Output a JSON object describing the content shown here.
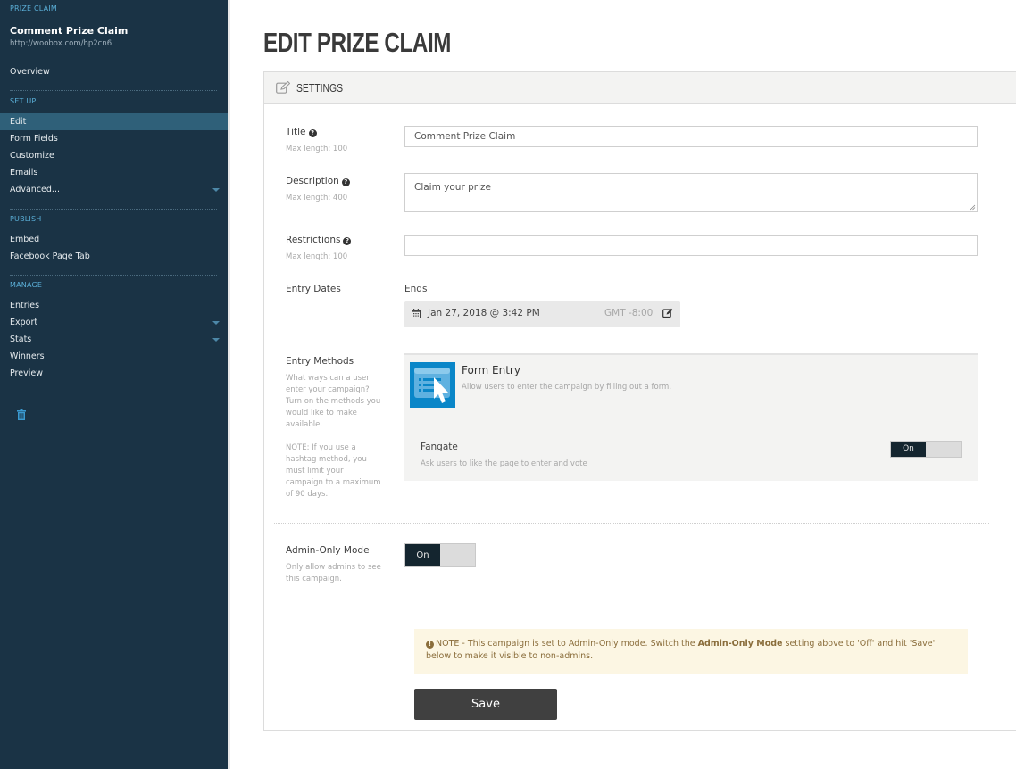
{
  "sidebar": {
    "kicker": "PRIZE CLAIM",
    "campaign_title": "Comment Prize Claim",
    "campaign_url": "http://woobox.com/hp2cn6",
    "overview": "Overview",
    "sections": {
      "setup": "SET UP",
      "publish": "PUBLISH",
      "manage": "MANAGE"
    },
    "setup_items": [
      {
        "label": "Edit",
        "active": true
      },
      {
        "label": "Form Fields"
      },
      {
        "label": "Customize"
      },
      {
        "label": "Emails"
      },
      {
        "label": "Advanced...",
        "has_caret": true
      }
    ],
    "publish_items": [
      {
        "label": "Embed"
      },
      {
        "label": "Facebook Page Tab"
      }
    ],
    "manage_items": [
      {
        "label": "Entries"
      },
      {
        "label": "Export",
        "has_caret": true
      },
      {
        "label": "Stats",
        "has_caret": true
      },
      {
        "label": "Winners"
      },
      {
        "label": "Preview"
      }
    ],
    "delete_icon": "trash-icon"
  },
  "main": {
    "page_title": "EDIT PRIZE CLAIM",
    "panel_title": "SETTINGS",
    "fields": {
      "title": {
        "label": "Title",
        "hint": "Max length: 100",
        "value": "Comment Prize Claim"
      },
      "description": {
        "label": "Description",
        "hint": "Max length: 400",
        "value": "Claim your prize"
      },
      "restrictions": {
        "label": "Restrictions",
        "hint": "Max length: 100",
        "value": ""
      },
      "entry_dates": {
        "label": "Entry Dates",
        "ends_label": "Ends",
        "ends_value": "Jan 27, 2018 @ 3:42 PM",
        "timezone": "GMT -8:00"
      }
    },
    "entry_methods": {
      "label": "Entry Methods",
      "help": "What ways can a user enter your campaign? Turn on the methods you would like to make available.",
      "note": "NOTE: If you use a hashtag method, you must limit your campaign to a maximum of 90 days.",
      "form_entry": {
        "title": "Form Entry",
        "desc": "Allow users to enter the campaign by filling out a form."
      },
      "fangate": {
        "title": "Fangate",
        "desc": "Ask users to like the page to enter and vote",
        "toggle": "On"
      }
    },
    "admin_only": {
      "label": "Admin-Only Mode",
      "help": "Only allow admins to see this campaign.",
      "toggle": "On"
    },
    "notice": {
      "prefix": "NOTE - This campaign is set to Admin-Only mode. Switch the ",
      "bold": "Admin-Only Mode",
      "suffix": " setting above to 'Off' and hit 'Save' below to make it visible to non-admins."
    },
    "save_label": "Save"
  },
  "colors": {
    "sidebar_bg": "#1a3345",
    "sidebar_active": "#2f6079",
    "accent_blue": "#5aaed6",
    "form_entry_blue": "#0a86c8",
    "toggle_on": "#14252f",
    "notice_bg": "#fcf6e3",
    "notice_text": "#8a6d3b",
    "save_bg": "#404040"
  }
}
